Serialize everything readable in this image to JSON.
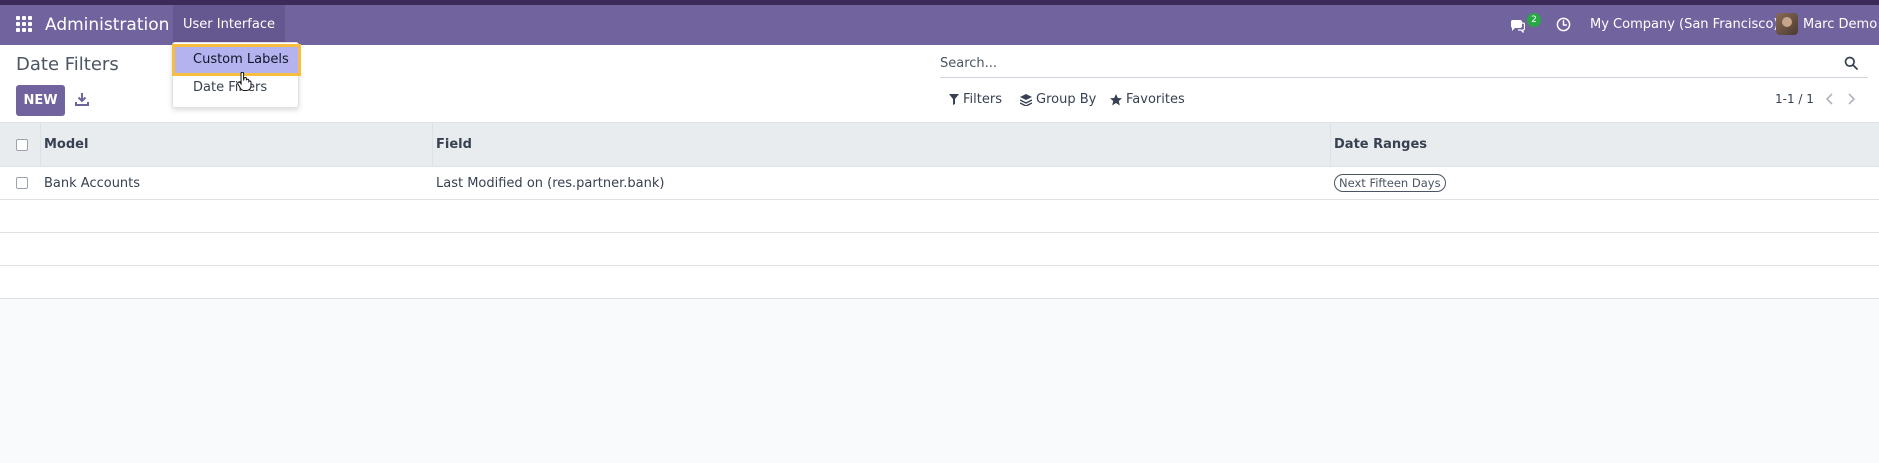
{
  "navbar": {
    "app_name": "Administration",
    "menu_item": "User Interface",
    "chat_badge": "2",
    "company": "My Company (San Francisco)",
    "user": "Marc Demo"
  },
  "dropdown": {
    "items": [
      "Custom Labels",
      "Date Filters"
    ],
    "highlighted": "Custom Labels"
  },
  "control": {
    "title": "Date Filters",
    "new_label": "NEW",
    "search_placeholder": "Search...",
    "filters_label": "Filters",
    "groupby_label": "Group By",
    "favorites_label": "Favorites",
    "pager": "1-1 / 1"
  },
  "table": {
    "headers": [
      "Model",
      "Field",
      "Date Ranges"
    ],
    "rows": [
      {
        "model": "Bank Accounts",
        "field": "Last Modified on (res.partner.bank)",
        "date_ranges": "Next Fifteen Days"
      }
    ]
  },
  "colors": {
    "navbar": "#71639e",
    "primary_button": "#71639e",
    "dropdown_highlight": "#b4b2ef",
    "focus_outline": "#f6bd3e",
    "badge": "#28a745"
  },
  "icons": [
    "apps-grid-icon",
    "chat-icon",
    "clock-icon",
    "download-icon",
    "search-icon",
    "filter-icon",
    "layers-icon",
    "star-icon",
    "chevron-left-icon",
    "chevron-right-icon",
    "hand-cursor-icon"
  ]
}
